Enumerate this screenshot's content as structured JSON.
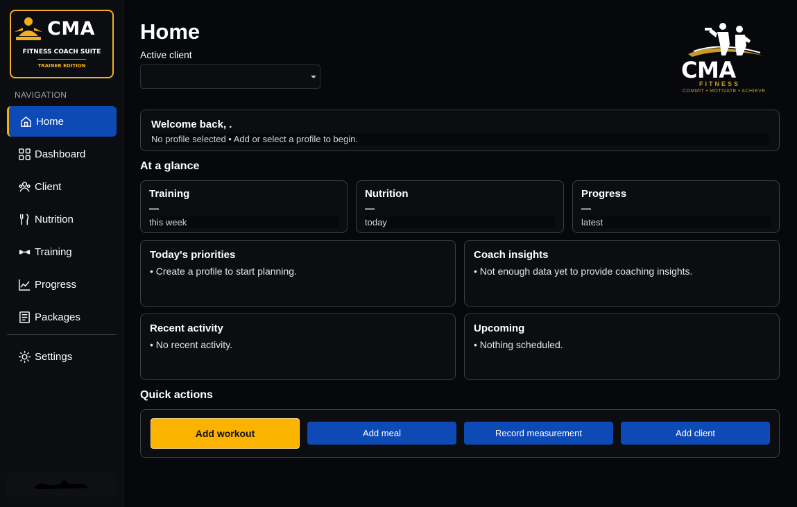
{
  "sidebar": {
    "brand": {
      "title": "CMA",
      "subtitle": "FITNESS COACH SUITE",
      "edition": "TRAINER EDITION"
    },
    "nav_heading": "NAVIGATION",
    "items": [
      {
        "label": "Home",
        "icon": "home-icon",
        "active": true
      },
      {
        "label": "Dashboard",
        "icon": "grid-icon"
      },
      {
        "label": "Client",
        "icon": "users-icon"
      },
      {
        "label": "Nutrition",
        "icon": "utensils-icon"
      },
      {
        "label": "Training",
        "icon": "dumbbell-icon"
      },
      {
        "label": "Progress",
        "icon": "chart-line-icon"
      },
      {
        "label": "Packages",
        "icon": "document-icon"
      }
    ],
    "settings": {
      "label": "Settings",
      "icon": "gear-icon"
    }
  },
  "header": {
    "title": "Home",
    "client_label": "Active client",
    "client_value": "",
    "logo": {
      "word": "CMA",
      "sub": "FITNESS",
      "tagline": "COMMIT • MOTIVATE • ACHIEVE"
    }
  },
  "welcome": {
    "title": "Welcome back, .",
    "subtitle": "No profile selected  •  Add or select a profile to begin."
  },
  "glance": {
    "title": "At a glance",
    "cards": [
      {
        "title": "Training",
        "value": "—",
        "sub": "this week"
      },
      {
        "title": "Nutrition",
        "value": "—",
        "sub": "today"
      },
      {
        "title": "Progress",
        "value": "—",
        "sub": "latest"
      }
    ]
  },
  "panels": {
    "priorities": {
      "title": "Today's priorities",
      "body": "• Create a profile to start planning."
    },
    "insights": {
      "title": "Coach insights",
      "body": "• Not enough data yet to provide coaching insights."
    },
    "activity": {
      "title": "Recent activity",
      "body": "• No recent activity."
    },
    "upcoming": {
      "title": "Upcoming",
      "body": "• Nothing scheduled."
    }
  },
  "quick_actions": {
    "title": "Quick actions",
    "buttons": [
      "Add workout",
      "Add meal",
      "Record measurement",
      "Add client"
    ]
  },
  "colors": {
    "accent": "#fbb300",
    "primary": "#0e4ab5",
    "background": "#06080b",
    "card": "#0b0d11"
  }
}
